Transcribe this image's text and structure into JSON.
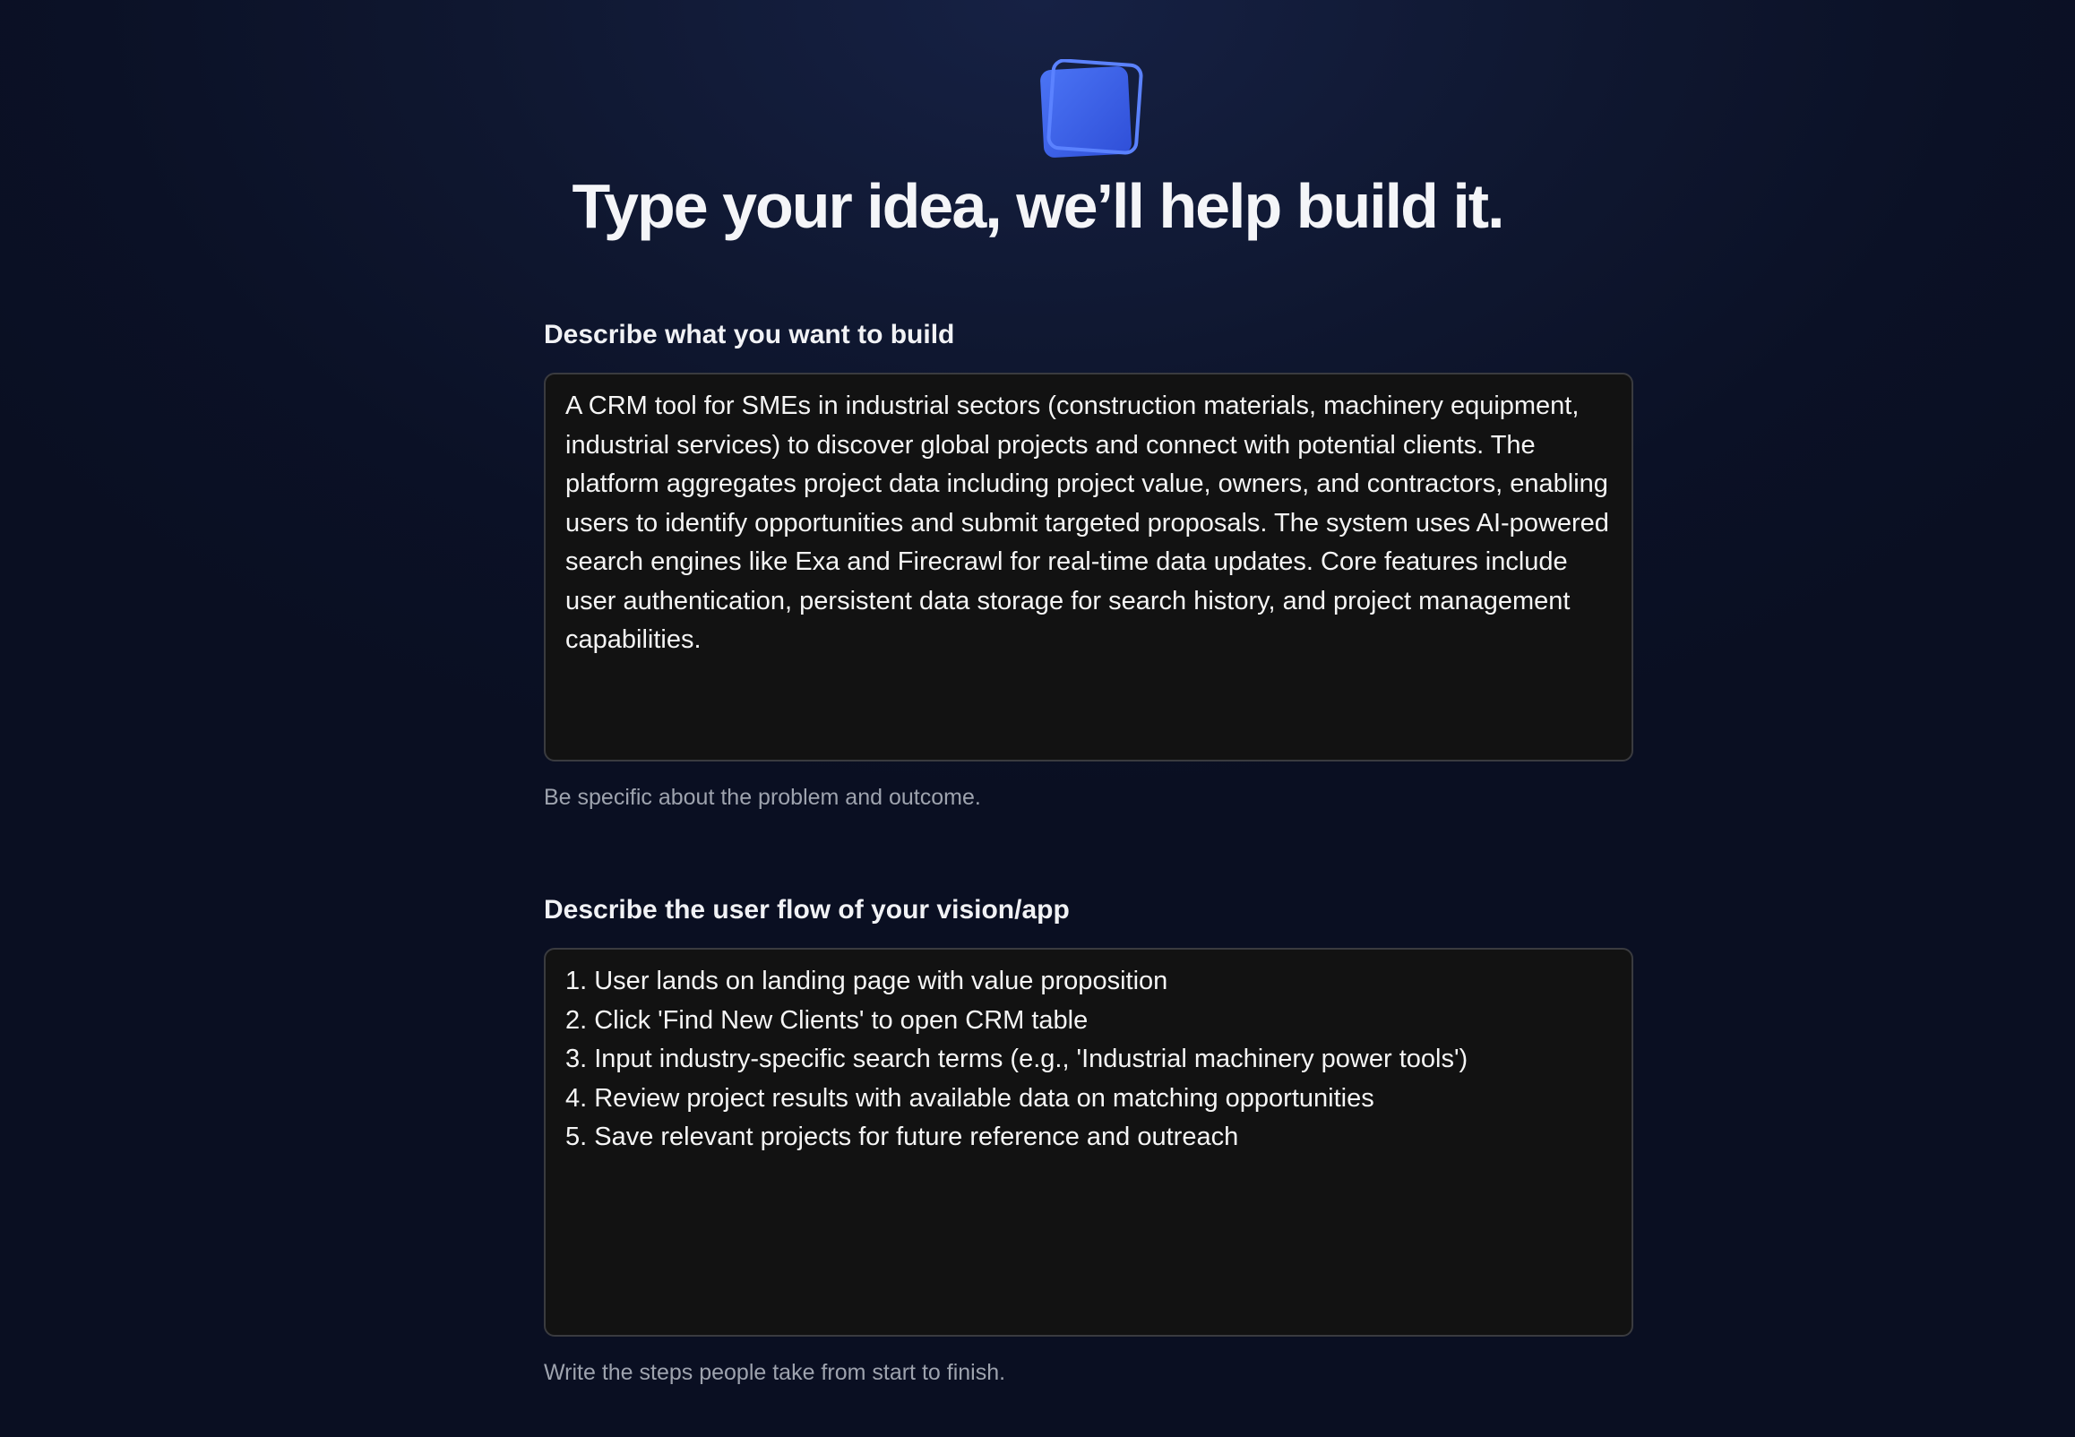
{
  "header": {
    "logo_icon": "stacked-square-logo-icon",
    "headline": "Type your idea, we’ll help build it."
  },
  "fields": {
    "build": {
      "label": "Describe what you want to build",
      "value": "A CRM tool for SMEs in industrial sectors (construction materials, machinery equipment, industrial services) to discover global projects and connect with potential clients. The platform aggregates project data including project value, owners, and contractors, enabling users to identify opportunities and submit targeted proposals. The system uses AI-powered search engines like Exa and Firecrawl for real-time data updates. Core features include user authentication, persistent data storage for search history, and project management capabilities.",
      "helper": "Be specific about the problem and outcome."
    },
    "flow": {
      "label": "Describe the user flow of your vision/app",
      "value": "1. User lands on landing page with value proposition\n2. Click 'Find New Clients' to open CRM table\n3. Input industry-specific search terms (e.g., 'Industrial machinery power tools')\n4. Review project results with available data on matching opportunities\n5. Save relevant projects for future reference and outreach",
      "helper": "Write the steps people take from start to finish."
    }
  },
  "colors": {
    "accent": "#3f63ec",
    "background": "#0f1730",
    "textarea_bg": "#121212"
  }
}
